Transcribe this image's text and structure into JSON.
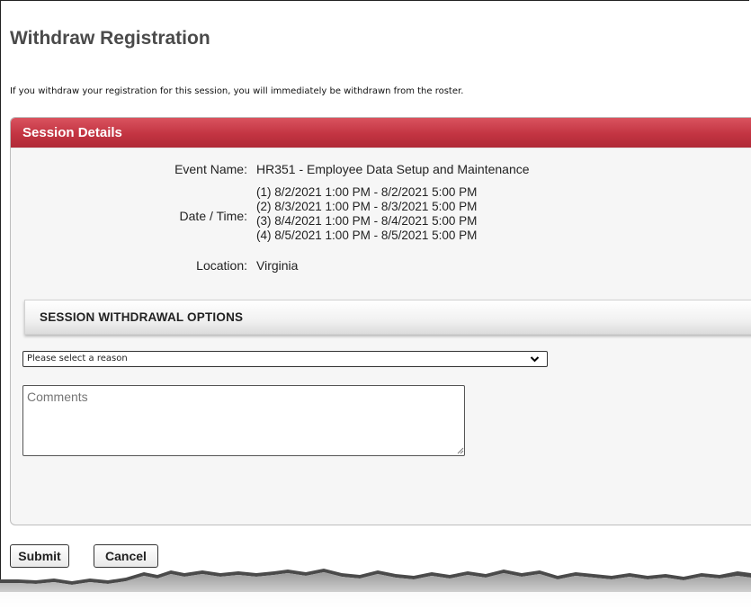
{
  "page": {
    "title": "Withdraw Registration",
    "intro": "If you withdraw your registration for this session, you will immediately be withdrawn from the roster."
  },
  "session_details": {
    "header": "Session Details",
    "event_name_label": "Event Name:",
    "event_name": "HR351 - Employee Data Setup and Maintenance",
    "datetime_label": "Date / Time:",
    "datetimes": [
      "(1) 8/2/2021 1:00 PM - 8/2/2021 5:00 PM",
      "(2) 8/3/2021 1:00 PM - 8/3/2021 5:00 PM",
      "(3) 8/4/2021 1:00 PM - 8/4/2021 5:00 PM",
      "(4) 8/5/2021 1:00 PM - 8/5/2021 5:00 PM"
    ],
    "location_label": "Location:",
    "location": "Virginia"
  },
  "withdrawal_options": {
    "title": "SESSION WITHDRAWAL OPTIONS",
    "reason_selected": "Please select a reason",
    "comments_placeholder": "Comments"
  },
  "actions": {
    "submit": "Submit",
    "cancel": "Cancel"
  },
  "icons": {
    "select": "chevron-down-icon",
    "resize": "resize-grip-icon"
  },
  "colors": {
    "header_red": "#c33442",
    "title_gray": "#4a4a4a",
    "panel_bg": "#f6f6f6"
  }
}
